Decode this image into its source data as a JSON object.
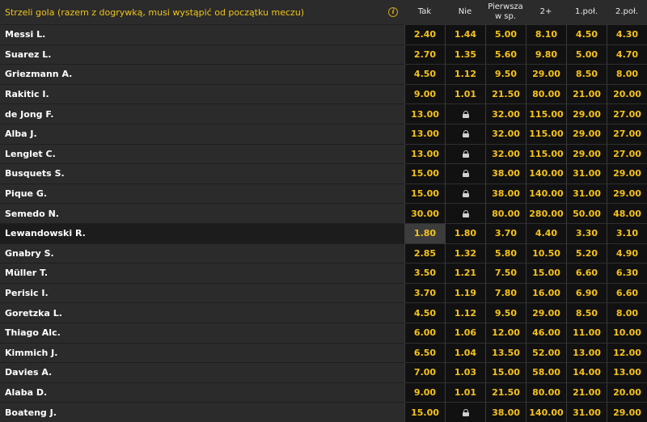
{
  "market": {
    "title": "Strzeli gola (razem z dogrywką, musi wystąpić od początku meczu)",
    "info_icon": "info-icon"
  },
  "columns": [
    "Tak",
    "Nie",
    "Pierwsza w sp.",
    "2+",
    "1.poł.",
    "2.poł."
  ],
  "rows": [
    {
      "name": "Messi L.",
      "odds": [
        "2.40",
        "1.44",
        "5.00",
        "8.10",
        "4.50",
        "4.30"
      ]
    },
    {
      "name": "Suarez L.",
      "odds": [
        "2.70",
        "1.35",
        "5.60",
        "9.80",
        "5.00",
        "4.70"
      ]
    },
    {
      "name": "Griezmann A.",
      "odds": [
        "4.50",
        "1.12",
        "9.50",
        "29.00",
        "8.50",
        "8.00"
      ]
    },
    {
      "name": "Rakitic I.",
      "odds": [
        "9.00",
        "1.01",
        "21.50",
        "80.00",
        "21.00",
        "20.00"
      ]
    },
    {
      "name": "de Jong F.",
      "odds": [
        "13.00",
        "locked",
        "32.00",
        "115.00",
        "29.00",
        "27.00"
      ]
    },
    {
      "name": "Alba J.",
      "odds": [
        "13.00",
        "locked",
        "32.00",
        "115.00",
        "29.00",
        "27.00"
      ]
    },
    {
      "name": "Lenglet C.",
      "odds": [
        "13.00",
        "locked",
        "32.00",
        "115.00",
        "29.00",
        "27.00"
      ]
    },
    {
      "name": "Busquets S.",
      "odds": [
        "15.00",
        "locked",
        "38.00",
        "140.00",
        "31.00",
        "29.00"
      ]
    },
    {
      "name": "Pique G.",
      "odds": [
        "15.00",
        "locked",
        "38.00",
        "140.00",
        "31.00",
        "29.00"
      ]
    },
    {
      "name": "Semedo N.",
      "odds": [
        "30.00",
        "locked",
        "80.00",
        "280.00",
        "50.00",
        "48.00"
      ]
    },
    {
      "name": "Lewandowski R.",
      "odds": [
        "1.80",
        "1.80",
        "3.70",
        "4.40",
        "3.30",
        "3.10"
      ],
      "selected": true
    },
    {
      "name": "Gnabry S.",
      "odds": [
        "2.85",
        "1.32",
        "5.80",
        "10.50",
        "5.20",
        "4.90"
      ]
    },
    {
      "name": "Müller T.",
      "odds": [
        "3.50",
        "1.21",
        "7.50",
        "15.00",
        "6.60",
        "6.30"
      ]
    },
    {
      "name": "Perisic I.",
      "odds": [
        "3.70",
        "1.19",
        "7.80",
        "16.00",
        "6.90",
        "6.60"
      ]
    },
    {
      "name": "Goretzka L.",
      "odds": [
        "4.50",
        "1.12",
        "9.50",
        "29.00",
        "8.50",
        "8.00"
      ]
    },
    {
      "name": "Thiago Alc.",
      "odds": [
        "6.00",
        "1.06",
        "12.00",
        "46.00",
        "11.00",
        "10.00"
      ]
    },
    {
      "name": "Kimmich J.",
      "odds": [
        "6.50",
        "1.04",
        "13.50",
        "52.00",
        "13.00",
        "12.00"
      ]
    },
    {
      "name": "Davies A.",
      "odds": [
        "7.00",
        "1.03",
        "15.00",
        "58.00",
        "14.00",
        "13.00"
      ]
    },
    {
      "name": "Alaba D.",
      "odds": [
        "9.00",
        "1.01",
        "21.50",
        "80.00",
        "21.00",
        "20.00"
      ]
    },
    {
      "name": "Boateng J.",
      "odds": [
        "15.00",
        "locked",
        "38.00",
        "140.00",
        "31.00",
        "29.00"
      ]
    }
  ]
}
